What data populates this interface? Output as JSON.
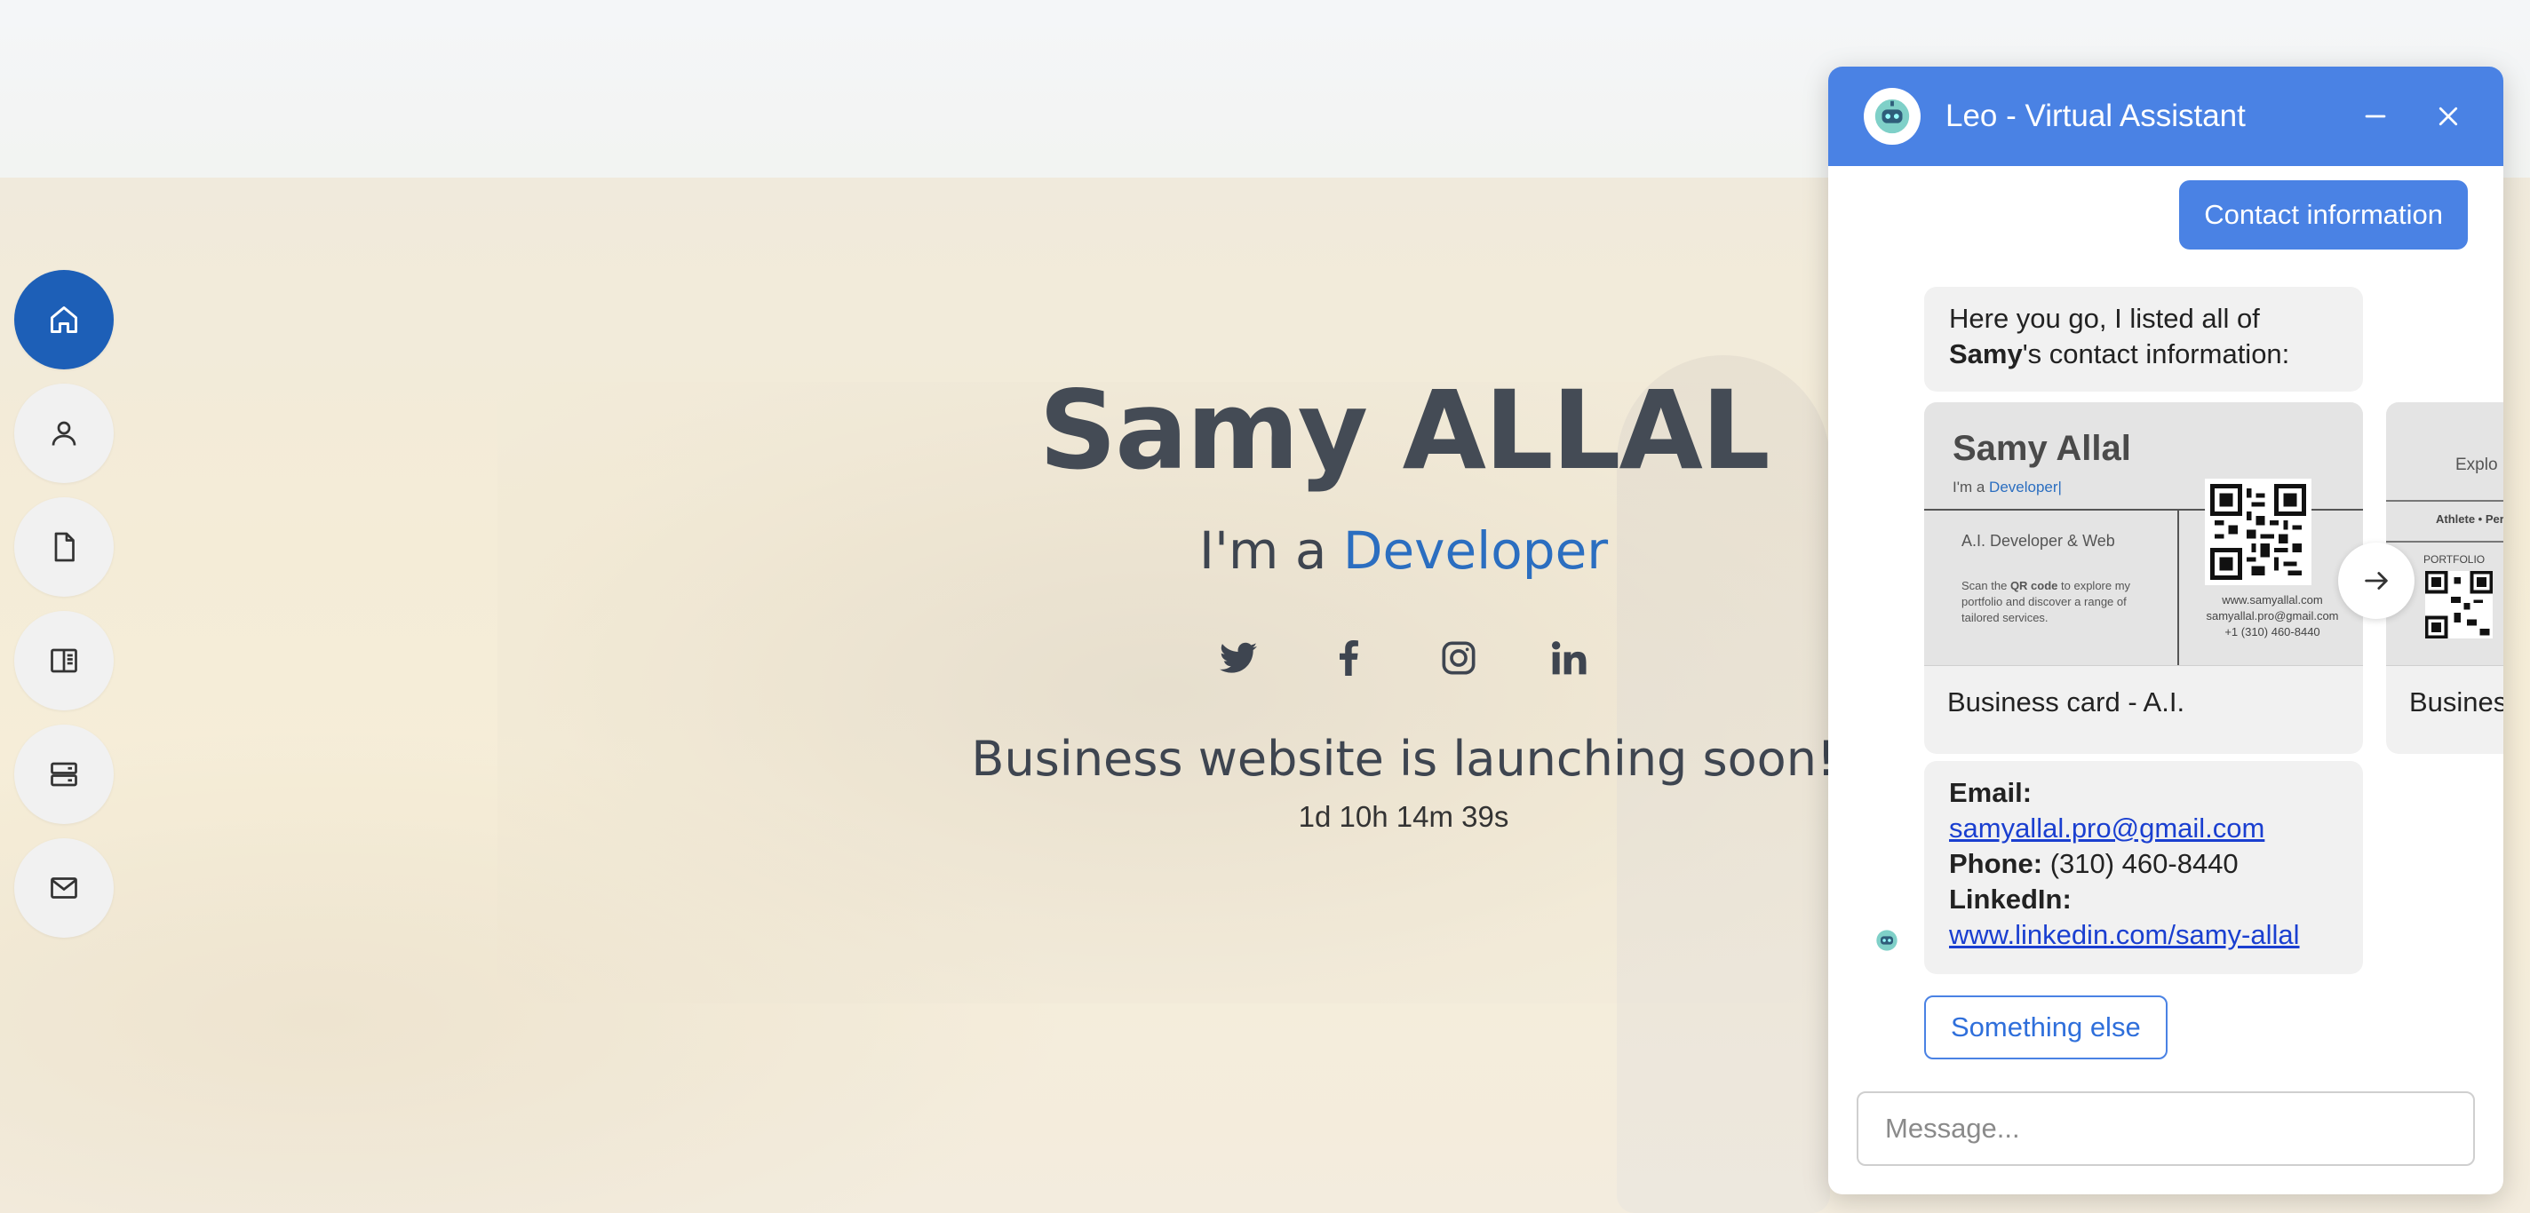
{
  "nav": {
    "items": [
      {
        "icon": "home-icon",
        "active": true
      },
      {
        "icon": "user-icon",
        "active": false
      },
      {
        "icon": "document-icon",
        "active": false
      },
      {
        "icon": "book-icon",
        "active": false
      },
      {
        "icon": "server-icon",
        "active": false
      },
      {
        "icon": "mail-icon",
        "active": false
      }
    ],
    "active_color": "#1d5fb7"
  },
  "hero": {
    "name": "Samy ALLAL",
    "role_prefix": "I'm a",
    "role": "Developer",
    "socials": [
      "twitter-icon",
      "facebook-icon",
      "instagram-icon",
      "linkedin-icon"
    ],
    "launch_text": "Business website is launching soon!",
    "countdown": "1d 10h 14m 39s",
    "accent_color": "#2b6ec0"
  },
  "chat": {
    "title": "Leo - Virtual Assistant",
    "header_color": "#4a82e4",
    "user_message": "Contact information",
    "bot_intro": {
      "line1": "Here you go, I listed all of",
      "bold": "Samy",
      "line2_rest": "'s contact information:"
    },
    "cards": [
      {
        "caption": "Business card - A.I.",
        "name": "Samy Allal",
        "role_prefix": "I'm a",
        "role": "Developer|",
        "subtitle": "A.I. Developer & Web",
        "description_parts": [
          "Scan the ",
          "QR code",
          " to explore my portfolio and discover a range of tailored services."
        ],
        "website": "www.samyallal.com",
        "email": "samyallal.pro@gmail.com",
        "phone": "+1 (310) 460-8440"
      },
      {
        "caption": "Busines",
        "explore": "Explo",
        "athlete": "Athlete • Per",
        "portfolio": "PORTFOLIO"
      }
    ],
    "contact": {
      "email_label": "Email:",
      "email": "samyallal.pro@gmail.com",
      "phone_label": "Phone:",
      "phone": "(310) 460-8440",
      "linkedin_label": "LinkedIn:",
      "linkedin": "www.linkedin.com/samy-allal"
    },
    "quick_reply": "Something else",
    "input_placeholder": "Message..."
  }
}
